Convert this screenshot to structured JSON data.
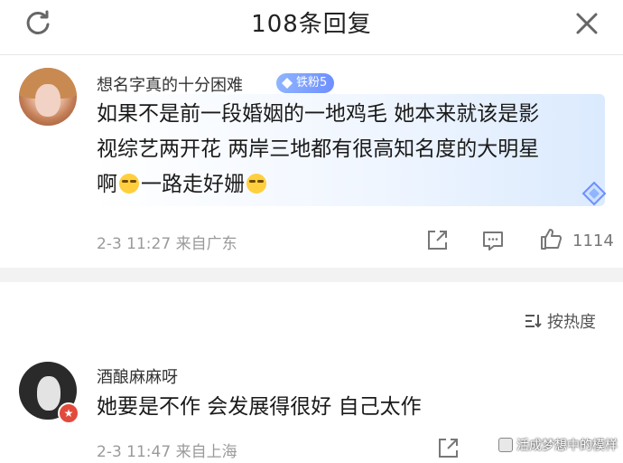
{
  "header": {
    "title": "108条回复"
  },
  "comments": [
    {
      "username": "想名字真的十分困难",
      "badge": "铁粉5",
      "lines": [
        "如果不是前一段婚姻的一地鸡毛 她本来就该是影",
        "视综艺两开花 两岸三地都有很高知名度的大明星"
      ],
      "line3a": "啊",
      "line3b": "一路走好姗",
      "meta": "2-3 11:27 来自广东",
      "likes": "1114",
      "emoji_icon": "crying-face-icon"
    },
    {
      "username": "酒酿麻麻呀",
      "text": "她要是不作 会发展得很好 自己太作",
      "meta": "2-3 11:47 来自上海"
    }
  ],
  "sort": {
    "label": "按热度"
  },
  "watermark": {
    "text": "活成梦想中的模样"
  },
  "colors": {
    "badge": "#6e8fff",
    "divider": "#f2f2f2",
    "meta": "#9a9a9a",
    "avatar_badge": "#e24a3b"
  }
}
